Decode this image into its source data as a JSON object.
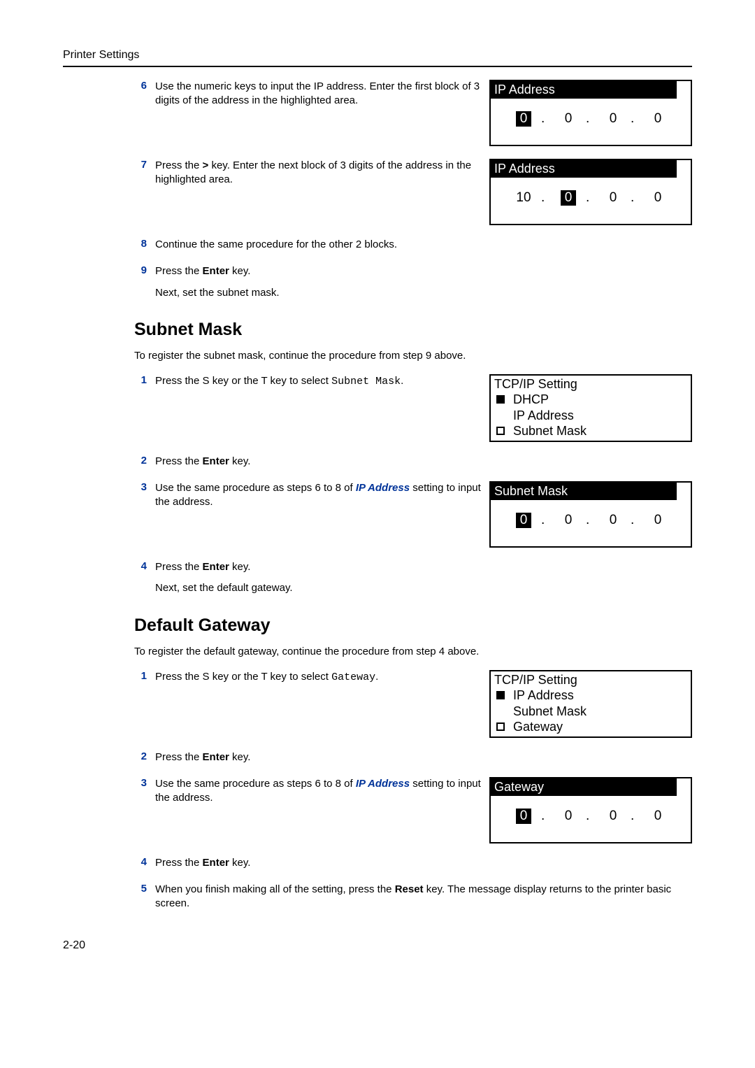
{
  "header": "Printer Settings",
  "footer": "2-20",
  "ip_link": "IP Address",
  "ip_section": {
    "s6": {
      "num": "6",
      "text": "Use the numeric keys to input the IP address. Enter the first block of 3 digits of the address in the highlighted area."
    },
    "s7": {
      "num": "7",
      "text_a": "Press the ",
      "text_b": " key. Enter the next block of 3 digits of the address in the highlighted area.",
      "bold": ">"
    },
    "s8": {
      "num": "8",
      "text": "Continue the same procedure for the other 2 blocks."
    },
    "s9": {
      "num": "9",
      "text_a": "Press the ",
      "text_b": " key.",
      "bold": "Enter",
      "sub": "Next, set the subnet mask."
    }
  },
  "lcd_ip1": {
    "title": "IP Address",
    "o1": "0",
    "o2": "0",
    "o3": "0",
    "o4": "0"
  },
  "lcd_ip2": {
    "title": "IP Address",
    "o1": "10",
    "o2": "0",
    "o3": "0",
    "o4": "0"
  },
  "subnet": {
    "heading": "Subnet Mask",
    "intro": "To register the subnet mask, continue the procedure from step 9 above.",
    "s1": {
      "num": "1",
      "a": "Press the ",
      "k1": "S",
      "b": " key or the ",
      "k2": "T",
      "c": " key to select ",
      "mono": "Subnet Mask",
      "d": "."
    },
    "s2": {
      "num": "2",
      "a": "Press the ",
      "bold": "Enter",
      "b": " key."
    },
    "s3": {
      "num": "3",
      "a": "Use the same procedure as steps 6 to 8 of ",
      "b": " setting to input the address."
    },
    "s4": {
      "num": "4",
      "a": "Press the ",
      "bold": "Enter",
      "b": " key.",
      "sub": "Next, set the default gateway."
    }
  },
  "menu1": {
    "title": "TCP/IP Setting",
    "i1": "DHCP",
    "i2": "IP Address",
    "i3": "Subnet Mask"
  },
  "lcd_subnet": {
    "title": "Subnet Mask",
    "o1": "0",
    "o2": "0",
    "o3": "0",
    "o4": "0"
  },
  "gateway": {
    "heading": "Default Gateway",
    "intro": "To register the default gateway, continue the procedure from step 4 above.",
    "s1": {
      "num": "1",
      "a": "Press the ",
      "k1": "S",
      "b": " key or the ",
      "k2": "T",
      "c": " key to select ",
      "mono": "Gateway",
      "d": "."
    },
    "s2": {
      "num": "2",
      "a": "Press the ",
      "bold": "Enter",
      "b": " key."
    },
    "s3": {
      "num": "3",
      "a": "Use the same procedure as steps 6 to 8 of ",
      "b": " setting to input the address."
    },
    "s4": {
      "num": "4",
      "a": "Press the ",
      "bold": "Enter",
      "b": " key."
    },
    "s5": {
      "num": "5",
      "a": "When you finish making all of the setting, press the ",
      "bold": "Reset",
      "b": " key. The message display returns to the printer basic screen."
    }
  },
  "menu2": {
    "title": "TCP/IP Setting",
    "i1": "IP Address",
    "i2": "Subnet Mask",
    "i3": "Gateway"
  },
  "lcd_gateway": {
    "title": "Gateway",
    "o1": "0",
    "o2": "0",
    "o3": "0",
    "o4": "0"
  }
}
